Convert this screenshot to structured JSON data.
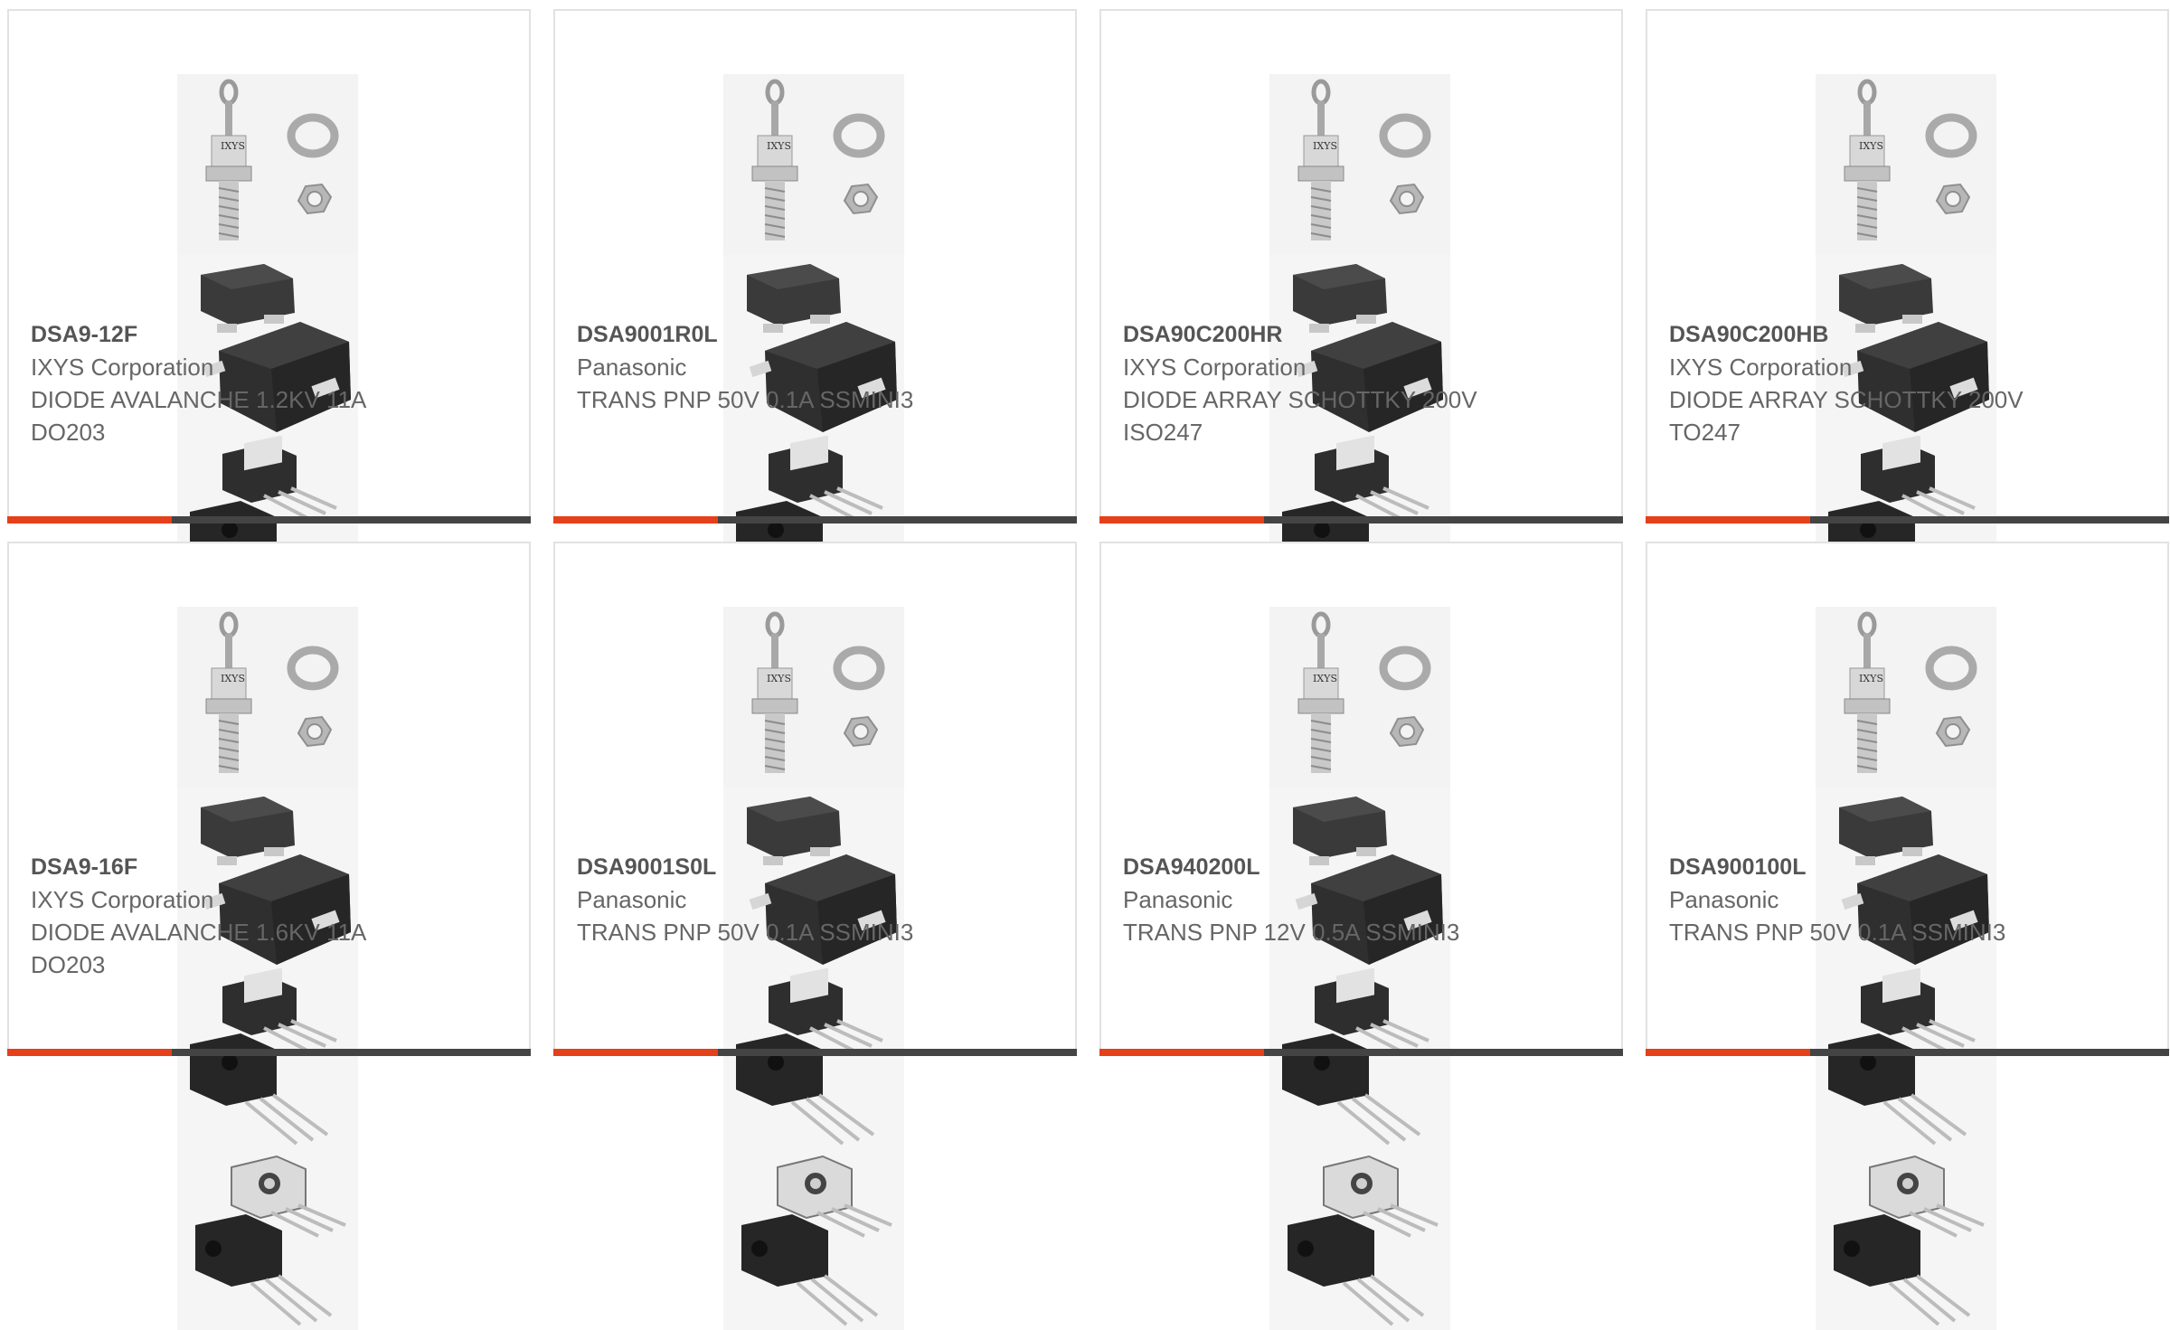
{
  "colors": {
    "accent": "#e5401a",
    "bar": "#444444",
    "border": "#e2e2e2",
    "title": "#555555",
    "text": "#666666"
  },
  "products": [
    {
      "part": "DSA9-12F",
      "manufacturer": "IXYS Corporation",
      "description": "DIODE AVALANCHE 1.2KV 11A DO203",
      "image": "stud-diode-with-washer-and-nut"
    },
    {
      "part": "DSA9001R0L",
      "manufacturer": "Panasonic",
      "description": "TRANS PNP 50V 0.1A SSMINI3",
      "image": "sot-package"
    },
    {
      "part": "DSA90C200HR",
      "manufacturer": "IXYS Corporation",
      "description": "DIODE ARRAY SCHOTTKY 200V ISO247",
      "image": "to247-package-isolated"
    },
    {
      "part": "DSA90C200HB",
      "manufacturer": "IXYS Corporation",
      "description": "DIODE ARRAY SCHOTTKY 200V TO247",
      "image": "to247-package"
    },
    {
      "part": "DSA9-16F",
      "manufacturer": "IXYS Corporation",
      "description": "DIODE AVALANCHE 1.6KV 11A DO203",
      "image": "stud-diode-with-washer-and-nut"
    },
    {
      "part": "DSA9001S0L",
      "manufacturer": "Panasonic",
      "description": "TRANS PNP 50V 0.1A SSMINI3",
      "image": "sot-package"
    },
    {
      "part": "DSA940200L",
      "manufacturer": "Panasonic",
      "description": "TRANS PNP 12V 0.5A SSMINI3",
      "image": "sot-package"
    },
    {
      "part": "DSA900100L",
      "manufacturer": "Panasonic",
      "description": "TRANS PNP 50V 0.1A SSMINI3",
      "image": "sot-package"
    }
  ],
  "diode_marking": "IXYS"
}
